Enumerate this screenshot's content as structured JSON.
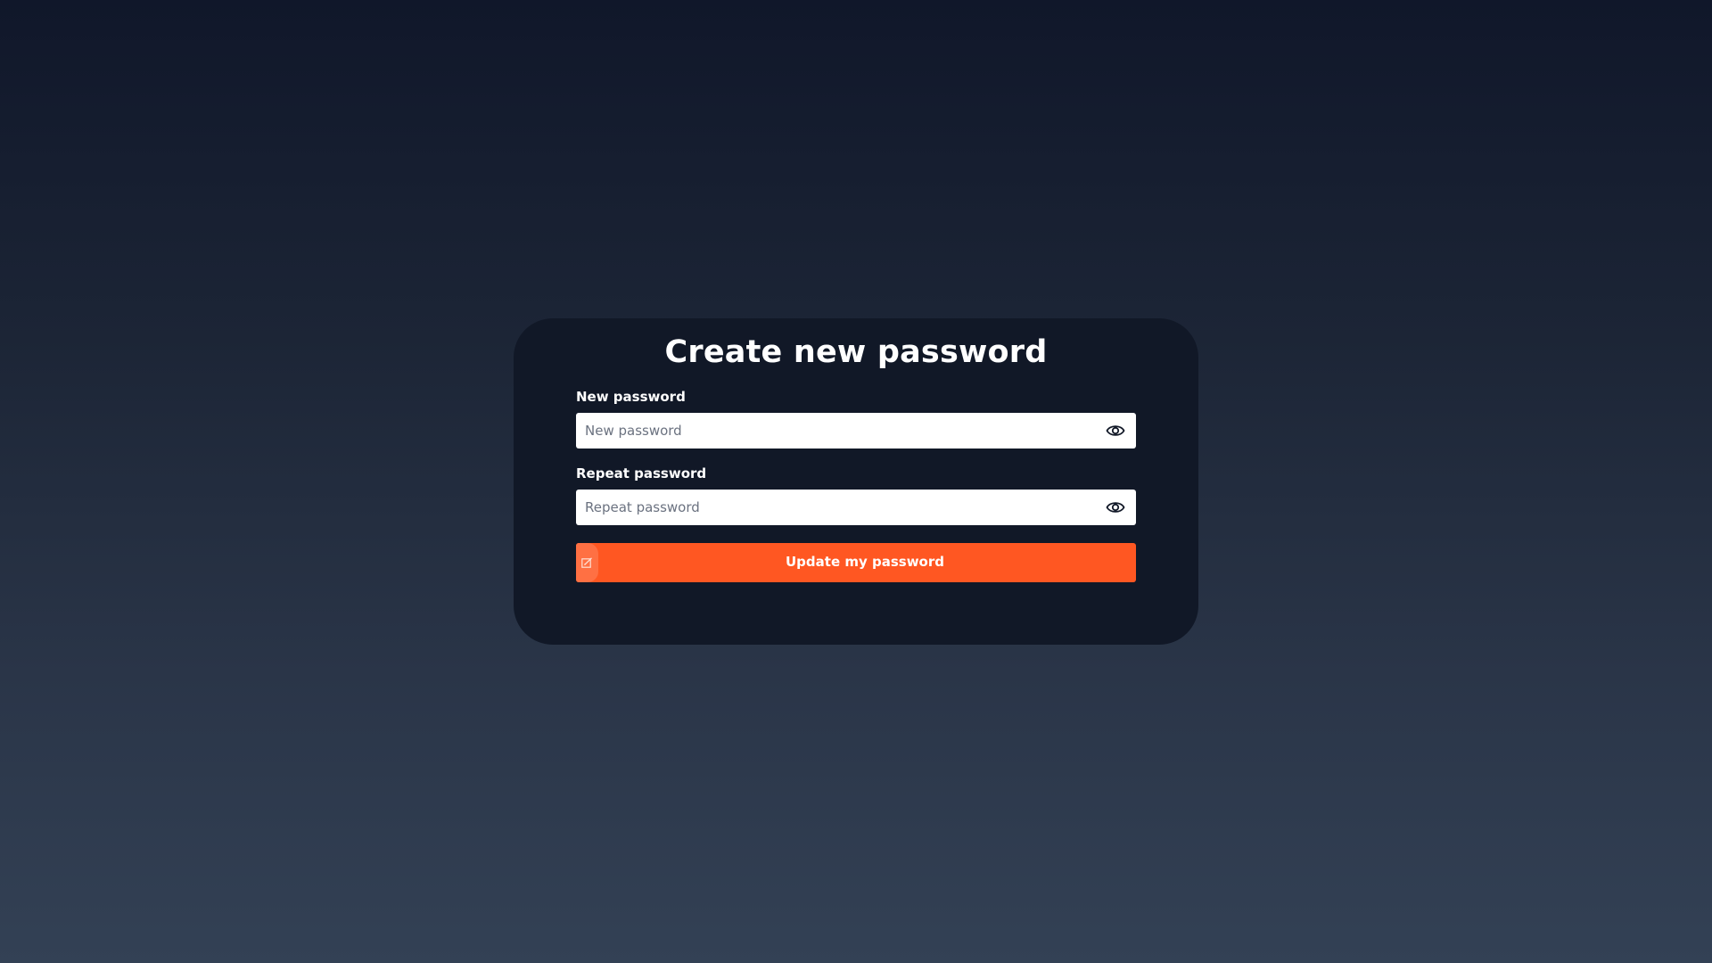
{
  "page": {
    "title": "Create new password"
  },
  "form": {
    "new_password": {
      "label": "New password",
      "placeholder": "New password",
      "value": ""
    },
    "repeat_password": {
      "label": "Repeat password",
      "placeholder": "Repeat password",
      "value": ""
    },
    "submit_label": "Update my password"
  },
  "icons": {
    "visibility_toggle": "eye-icon",
    "submit_icon": "edit-icon"
  },
  "colors": {
    "background_top": "#10172a",
    "background_bottom": "#334155",
    "card": "#111827",
    "accent": "#ff5722",
    "input_bg": "#ffffff"
  }
}
